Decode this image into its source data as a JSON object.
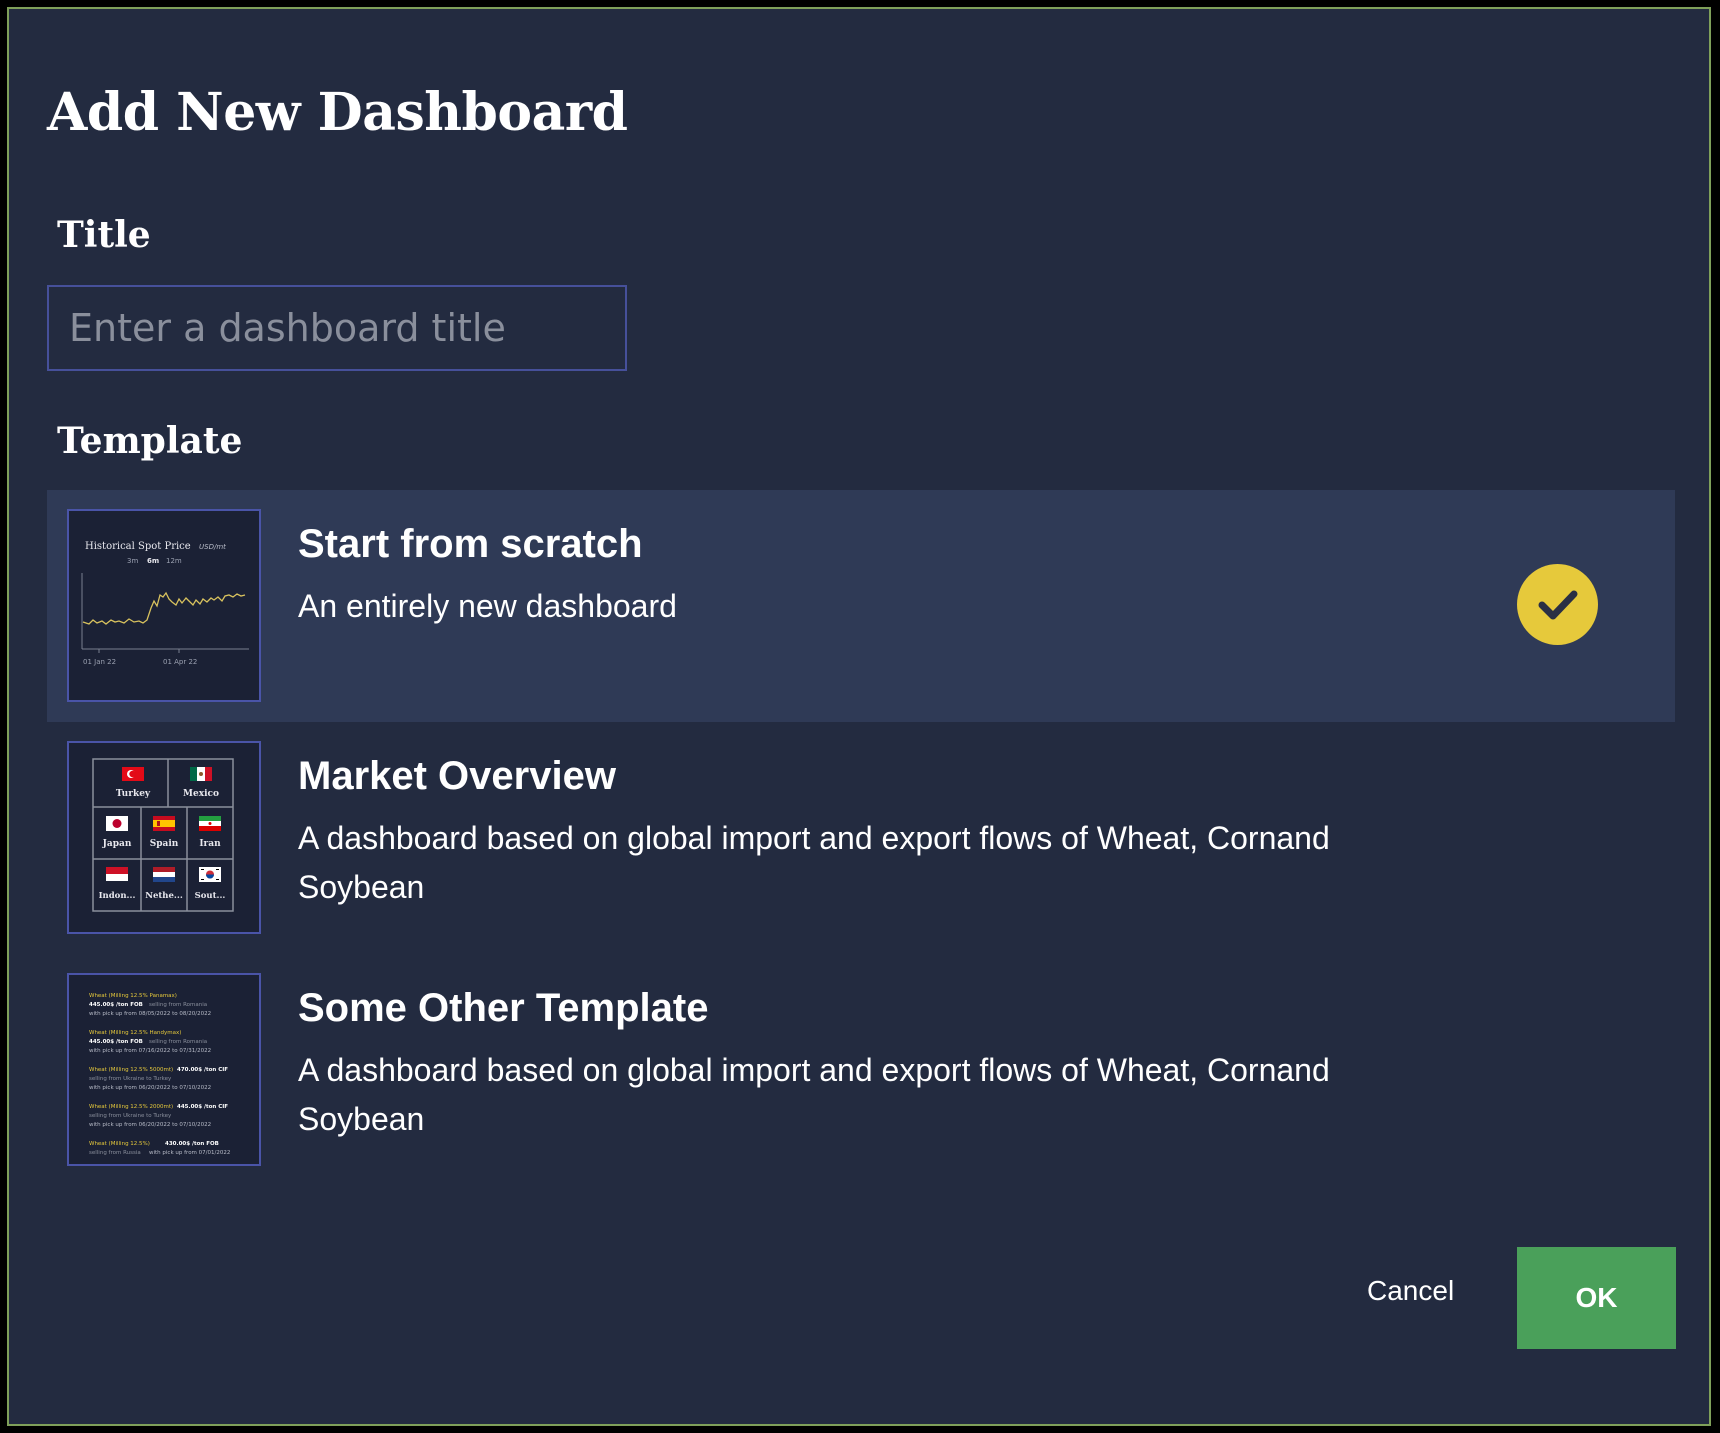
{
  "dialog": {
    "heading": "Add New Dashboard",
    "title_label": "Title",
    "title_input": {
      "value": "",
      "placeholder": "Enter a dashboard title"
    },
    "template_label": "Template",
    "templates": [
      {
        "name": "Start from scratch",
        "description": "An entirely new dashboard",
        "selected": true,
        "thumbnail": {
          "title": "Historical Spot Price",
          "unit": "USD/mt",
          "ranges": [
            "3m",
            "6m",
            "12m"
          ],
          "x_labels": [
            "01 Jan 22",
            "01 Apr 22"
          ]
        }
      },
      {
        "name": "Market Overview",
        "description": "A dashboard based on global import and export flows of Wheat, Cornand Soybean",
        "selected": false,
        "thumbnail": {
          "countries": [
            "Turkey",
            "Mexico",
            "Japan",
            "Spain",
            "Iran",
            "Indon...",
            "Nethe...",
            "Sout..."
          ]
        }
      },
      {
        "name": "Some Other Template",
        "description": "A dashboard based on global import and export flows of Wheat, Cornand Soybean",
        "selected": false,
        "thumbnail": {
          "offers": [
            {
              "product": "Wheat (Milling 12.5% Panamax)",
              "price": "445.00$ /ton FOB",
              "route": "selling from Romania",
              "dates": "with pick up from 08/05/2022 to 08/20/2022"
            },
            {
              "product": "Wheat (Milling 12.5% Handymax)",
              "price": "445.00$ /ton FOB",
              "route": "selling from Romania",
              "dates": "with pick up from 07/16/2022 to 07/31/2022"
            },
            {
              "product": "Wheat (Milling 12.5% 5000mt)",
              "price": "470.00$ /ton CIF",
              "route": "selling from Ukraine to Turkey",
              "dates": "with pick up from 06/20/2022 to 07/10/2022"
            },
            {
              "product": "Wheat (Milling 12.5% 2000mt)",
              "price": "445.00$ /ton CIF",
              "route": "selling from Ukraine to Turkey",
              "dates": "with pick up from 06/20/2022 to 07/10/2022"
            },
            {
              "product": "Wheat (Milling 12.5%)",
              "price": "430.00$ /ton FOB",
              "route": "selling from Russia",
              "dates": "with pick up from 07/01/2022"
            }
          ]
        }
      }
    ],
    "cancel_label": "Cancel",
    "ok_label": "OK",
    "colors": {
      "accent": "#e6c93b",
      "ok": "#4aa05a",
      "background": "#232b40",
      "selected_row": "#2f3a56"
    }
  }
}
